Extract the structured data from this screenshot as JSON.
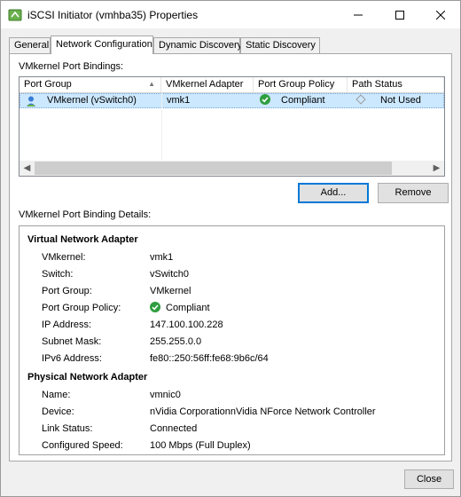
{
  "window": {
    "title": "iSCSI Initiator (vmhba35) Properties"
  },
  "tabs": [
    {
      "label": "General"
    },
    {
      "label": "Network Configuration"
    },
    {
      "label": "Dynamic Discovery"
    },
    {
      "label": "Static Discovery"
    }
  ],
  "bindings": {
    "section_label": "VMkernel Port Bindings:",
    "columns": [
      "Port Group",
      "VMkernel Adapter",
      "Port Group Policy",
      "Path Status"
    ],
    "rows": [
      {
        "port_group": "VMkernel (vSwitch0)",
        "adapter": "vmk1",
        "policy": "Compliant",
        "path_status": "Not Used"
      }
    ],
    "add_label": "Add...",
    "remove_label": "Remove"
  },
  "details": {
    "section_label": "VMkernel Port Binding Details:",
    "virtual": {
      "title": "Virtual Network Adapter",
      "fields": [
        {
          "label": "VMkernel:",
          "value": "vmk1"
        },
        {
          "label": "Switch:",
          "value": "vSwitch0"
        },
        {
          "label": "Port Group:",
          "value": "VMkernel"
        },
        {
          "label": "Port Group Policy:",
          "value": "Compliant"
        },
        {
          "label": "IP Address:",
          "value": "147.100.100.228"
        },
        {
          "label": "Subnet Mask:",
          "value": "255.255.0.0"
        },
        {
          "label": "IPv6 Address:",
          "value": "fe80::250:56ff:fe68:9b6c/64"
        }
      ]
    },
    "physical": {
      "title": "Physical Network Adapter",
      "fields": [
        {
          "label": "Name:",
          "value": "vmnic0"
        },
        {
          "label": "Device:",
          "value": "nVidia CorporationnVidia NForce Network Controller"
        },
        {
          "label": "Link Status:",
          "value": "Connected"
        },
        {
          "label": "Configured Speed:",
          "value": "100 Mbps (Full Duplex)"
        }
      ]
    }
  },
  "footer": {
    "close_label": "Close"
  },
  "colors": {
    "selection": "#cce8ff",
    "compliant": "#2e9e3e",
    "focus_border": "#0078d7"
  }
}
